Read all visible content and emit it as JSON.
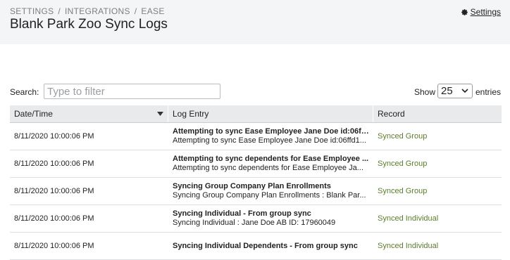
{
  "header": {
    "breadcrumb": [
      "SETTINGS",
      "INTEGRATIONS",
      "EASE"
    ],
    "title": "Blank Park Zoo Sync Logs",
    "settings_link": "Settings",
    "settings_icon": "gear-icon"
  },
  "filter": {
    "search_label": "Search:",
    "search_placeholder": "Type to filter",
    "search_value": ""
  },
  "paging": {
    "show_label": "Show",
    "entries_value": "25",
    "entries_label": "entries"
  },
  "table": {
    "columns": [
      "Date/Time",
      "Log Entry",
      "Record"
    ],
    "sorted_column": "Date/Time",
    "rows": [
      {
        "datetime": "8/11/2020 10:00:06 PM",
        "title": "Attempting to sync Ease Employee Jane Doe id:06ffd1...",
        "detail": "Attempting to sync Ease Employee Jane Doe id:06ffd1...",
        "record": "Synced Group"
      },
      {
        "datetime": "8/11/2020 10:00:06 PM",
        "title": "Attempting to sync dependents for Ease Employee ...",
        "detail": "Attempting to sync dependents for Ease Employee Ja...",
        "record": "Synced Group"
      },
      {
        "datetime": "8/11/2020 10:00:06 PM",
        "title": "Syncing Group Company Plan Enrollments",
        "detail": "Syncing Group Company Plan Enrollments : Blank Par...",
        "record": "Synced Group"
      },
      {
        "datetime": "8/11/2020 10:00:06 PM",
        "title": "Syncing Individual - From group sync",
        "detail": "Syncing Individual : Jane Doe AB ID: 17960049",
        "record": "Synced Individual"
      },
      {
        "datetime": "8/11/2020 10:00:06 PM",
        "title": "Syncing Individual Dependents - From group sync",
        "detail": "",
        "record": "Synced Individual"
      }
    ]
  }
}
